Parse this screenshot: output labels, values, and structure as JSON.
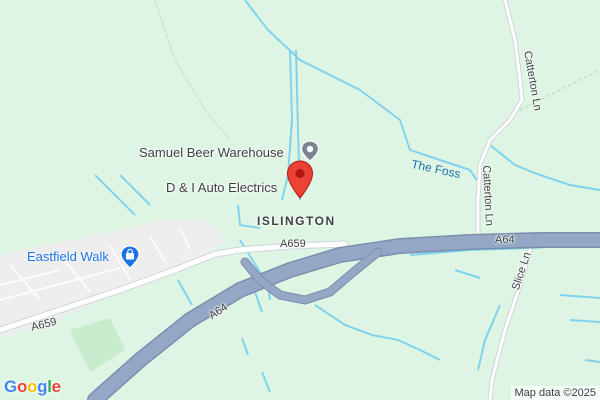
{
  "map": {
    "background_color": "#dff5e3",
    "water_color": "#7fd3ee",
    "motorway_color": "#8fa3c0",
    "road_color": "#ffffff",
    "urban_color": "#eeeeef",
    "marker_color": "#ea4335"
  },
  "labels": {
    "poi_samuel": "Samuel Beer Warehouse",
    "poi_auto": "D & I Auto Electrics",
    "area_islington": "ISLINGTON",
    "poi_eastfield": "Eastfield Walk",
    "road_a659_center": "A659",
    "road_a659_left": "A659",
    "road_a64_left": "A64",
    "road_a64_right": "A64",
    "road_catterton_top": "Catterton Ln",
    "road_catterton_mid": "Catterton Ln",
    "road_slice": "Slice Ln",
    "water_foss": "The Foss"
  },
  "attribution": {
    "map_data": "Map data ©2025",
    "logo": "Google",
    "logo_colors": [
      "#4285F4",
      "#EA4335",
      "#FBBC05",
      "#4285F4",
      "#34A853",
      "#EA4335"
    ]
  },
  "icons": {
    "poi_samuel": "place-pin-icon",
    "poi_auto": "location-marker-icon",
    "poi_eastfield": "shopping-bag-icon"
  }
}
